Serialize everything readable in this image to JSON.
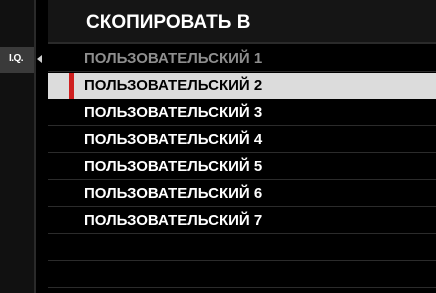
{
  "tab": {
    "label": "I.Q.",
    "arrow_icon": "chevron-left-icon"
  },
  "panel": {
    "title": "СКОПИРОВАТЬ В",
    "items": [
      {
        "label": "ПОЛЬЗОВАТЕЛЬСКИЙ 1",
        "state": "disabled"
      },
      {
        "label": "ПОЛЬЗОВАТЕЛЬСКИЙ 2",
        "state": "selected"
      },
      {
        "label": "ПОЛЬЗОВАТЕЛЬСКИЙ 3",
        "state": "normal"
      },
      {
        "label": "ПОЛЬЗОВАТЕЛЬСКИЙ 4",
        "state": "normal"
      },
      {
        "label": "ПОЛЬЗОВАТЕЛЬСКИЙ 5",
        "state": "normal"
      },
      {
        "label": "ПОЛЬЗОВАТЕЛЬСКИЙ 6",
        "state": "normal"
      },
      {
        "label": "ПОЛЬЗОВАТЕЛЬСКИЙ 7",
        "state": "normal"
      }
    ]
  },
  "colors": {
    "background": "#000000",
    "highlight": "#dcdcdc",
    "selection_marker": "#cf1f1f",
    "disabled_text": "#8e8e8e"
  }
}
